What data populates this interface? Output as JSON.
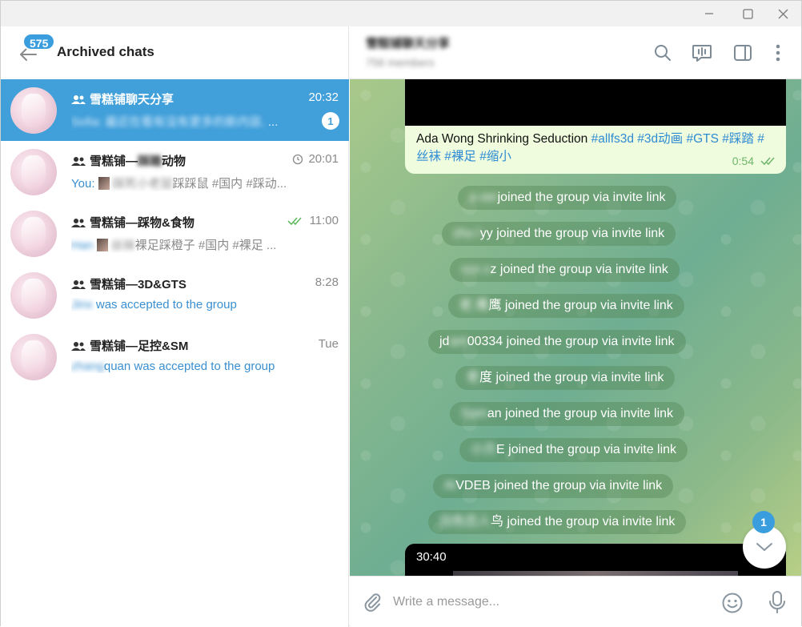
{
  "window": {
    "minimize_icon": "minimize-icon",
    "maximize_icon": "maximize-icon",
    "close_icon": "close-icon"
  },
  "sidebar": {
    "unread_total": "575",
    "title": "Archived chats",
    "chats": [
      {
        "name": "雪糕铺聊天分享",
        "time": "20:32",
        "preview_blurred": "Sofia: 最近在看有没有更多的新内容,",
        "preview_tail": " ...",
        "unread": "1",
        "active": true
      },
      {
        "name_prefix": "雪糕铺—",
        "name_blurred": "踩踏",
        "name_suffix": "动物",
        "time": "20:01",
        "preview_you": "You: ",
        "preview_blurred": "踩死小老鼠",
        "preview_text": "踩踩鼠 #国内 #踩动..."
      },
      {
        "name": "雪糕铺—踩物&食物",
        "time": "11:00",
        "preview_blurred": "Han",
        "preview_blurred_2": "丝袜",
        "preview_text": "裸足踩橙子 #国内 #裸足 ..."
      },
      {
        "name": "雪糕铺—3D&GTS",
        "time": "8:28",
        "preview_blurred": "Jinx",
        "preview_text": " was accepted to the group"
      },
      {
        "name": "雪糕铺—足控&SM",
        "time": "Tue",
        "preview_blurred": "zhang",
        "preview_text": "quan was accepted to the group"
      }
    ]
  },
  "chat": {
    "title": "雪糕铺聊天分享",
    "members": "756 members",
    "message": {
      "title": "Ada Wong Shrinking Seduction ",
      "hashtags": "#allfs3d #3d动画 #GTS #踩踏 #丝袜 #裸足 #缩小",
      "time": "0:54"
    },
    "service_messages": [
      {
        "blurred": "a ver",
        "text": "joined the group via invite link"
      },
      {
        "blurred": "zhu l",
        "text": "yy joined the group via invite link"
      },
      {
        "blurred": "xxx x",
        "text": "z joined the group via invite link"
      },
      {
        "blurred": "老 鹰",
        "text": "鹰 joined the group via invite link"
      },
      {
        "blurred": "jd",
        "text2": "00334 joined the group via invite link",
        "blurred_mid": " ant"
      },
      {
        "blurred": "老 ",
        "text": "度 joined the group via invite link"
      },
      {
        "blurred": "Sam ",
        "text": "an joined the group via invite link"
      },
      {
        "blurred": "小方",
        "text": "E joined the group via invite link"
      },
      {
        "blurred": "Al",
        "text": "VDEB joined the group via invite link"
      },
      {
        "blurred": "白色恋人",
        "text": "鸟 joined the group via invite link"
      }
    ],
    "video": {
      "duration": "30:40"
    },
    "scroll_unread": "1",
    "composer": {
      "placeholder": "Write a message..."
    }
  },
  "colors": {
    "accent": "#419fd9",
    "badge": "#3a9ede",
    "outgoing_bubble": "#effdde",
    "hashtag": "#2f8bd4",
    "read_check": "#6fb56b"
  }
}
